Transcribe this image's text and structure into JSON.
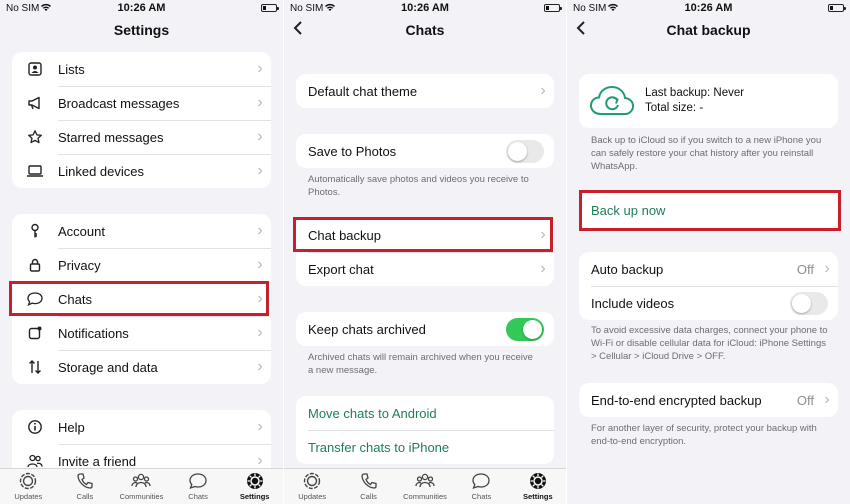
{
  "status": {
    "carrier": "No SIM",
    "time": "10:26 AM"
  },
  "screen1": {
    "title": "Settings",
    "group1": [
      "Lists",
      "Broadcast messages",
      "Starred messages",
      "Linked devices"
    ],
    "group2": [
      "Account",
      "Privacy",
      "Chats",
      "Notifications",
      "Storage and data"
    ],
    "group3": [
      "Help",
      "Invite a friend"
    ]
  },
  "screen2": {
    "title": "Chats",
    "default_theme": "Default chat theme",
    "save_to_photos": "Save to Photos",
    "save_note": "Automatically save photos and videos you receive to Photos.",
    "chat_backup": "Chat backup",
    "export_chat": "Export chat",
    "keep_archived": "Keep chats archived",
    "archived_note": "Archived chats will remain archived when you receive a new message.",
    "move_android": "Move chats to Android",
    "transfer_iphone": "Transfer chats to iPhone"
  },
  "screen3": {
    "title": "Chat backup",
    "last_backup": "Last backup: Never",
    "total_size": "Total size: -",
    "icloud_note": "Back up to iCloud so if you switch to a new iPhone you can safely restore your chat history after you reinstall WhatsApp.",
    "back_up_now": "Back up now",
    "auto_backup": "Auto backup",
    "auto_backup_value": "Off",
    "include_videos": "Include videos",
    "data_note": "To avoid excessive data charges, connect your phone to Wi-Fi or disable cellular data for iCloud: iPhone Settings > Cellular > iCloud Drive > OFF.",
    "e2e_backup": "End-to-end encrypted backup",
    "e2e_value": "Off",
    "e2e_note": "For another layer of security, protect your backup with end-to-end encryption."
  },
  "tabs": [
    "Updates",
    "Calls",
    "Communities",
    "Chats",
    "Settings"
  ],
  "colors": {
    "accent_green": "#1f7e57",
    "toggle_on": "#34c759",
    "highlight": "#c8202a"
  }
}
